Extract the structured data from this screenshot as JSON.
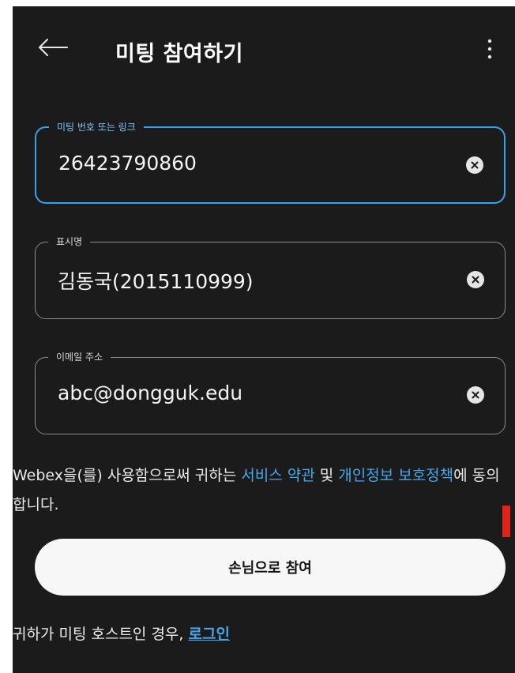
{
  "header": {
    "back_icon": "arrow-left-icon",
    "title": "미팅 참여하기",
    "menu_icon": "more-vertical-icon"
  },
  "fields": [
    {
      "label": "미팅 번호 또는 링크",
      "value": "26423790860",
      "active": true
    },
    {
      "label": "표시명",
      "value": "김동국(2015110999)",
      "active": false
    },
    {
      "label": "이메일 주소",
      "value": "abc@dongguk.edu",
      "active": false
    }
  ],
  "terms": {
    "prefix": "Webex을(를) 사용함으로써 귀하는 ",
    "service_link": "서비스 약관",
    "middle": " 및 ",
    "privacy_link": "개인정보 보호정책",
    "suffix": "에 동의합니다."
  },
  "guest_button": {
    "label": "손님으로 참여"
  },
  "host": {
    "prefix": "귀하가 미팅 호스트인 경우, ",
    "login_link": "로그인"
  },
  "colors": {
    "background": "#1b1b1b",
    "accent": "#3aa0e8",
    "link": "#46a6ec",
    "button": "#f7f7f7"
  }
}
